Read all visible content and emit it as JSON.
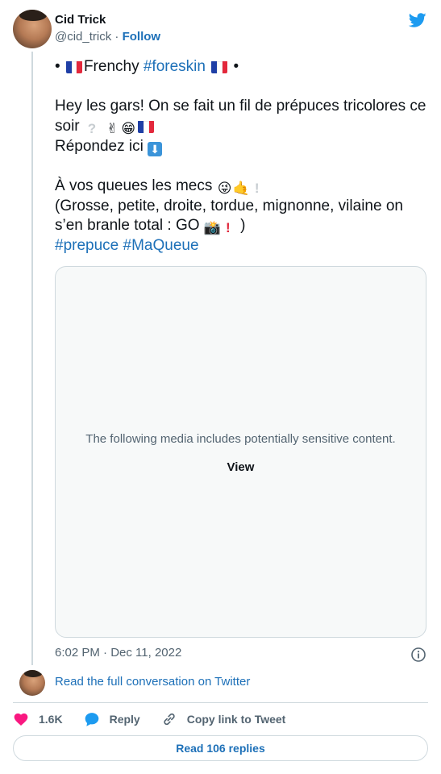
{
  "author": {
    "name": "Cid Trick",
    "handle": "@cid_trick",
    "separator": "·",
    "follow_label": "Follow"
  },
  "tweet": {
    "line1_pre": "•",
    "line1_word": "Frenchy",
    "line1_hashtag": "#foreskin",
    "line1_post": "•",
    "line2": "Hey les gars! On se fait un fil de prépuces tricolores ce soir",
    "line3": "Répondez ici",
    "line4": "À vos queues les mecs",
    "line5": "(Grosse, petite, droite, tordue, mignonne, vilaine on s’en branle total : GO",
    "line5_end": ")",
    "hashtags": [
      "#prepuce",
      "#MaQueue"
    ]
  },
  "media": {
    "warning": "The following media includes potentially sensitive content.",
    "view_label": "View"
  },
  "timestamp": "6:02 PM · Dec 11, 2022",
  "conversation_link": "Read the full conversation on Twitter",
  "actions": {
    "likes": "1.6K",
    "reply_label": "Reply",
    "copy_label": "Copy link to Tweet"
  },
  "read_replies_label": "Read 106 replies",
  "colors": {
    "link": "#1d70b8",
    "twitter_blue": "#1d9bf0",
    "heart": "#f91880",
    "border": "#cfd9de",
    "muted": "#536471"
  },
  "icons": [
    "twitter-bird-icon",
    "info-icon",
    "heart-icon",
    "reply-bubble-icon",
    "link-icon"
  ]
}
